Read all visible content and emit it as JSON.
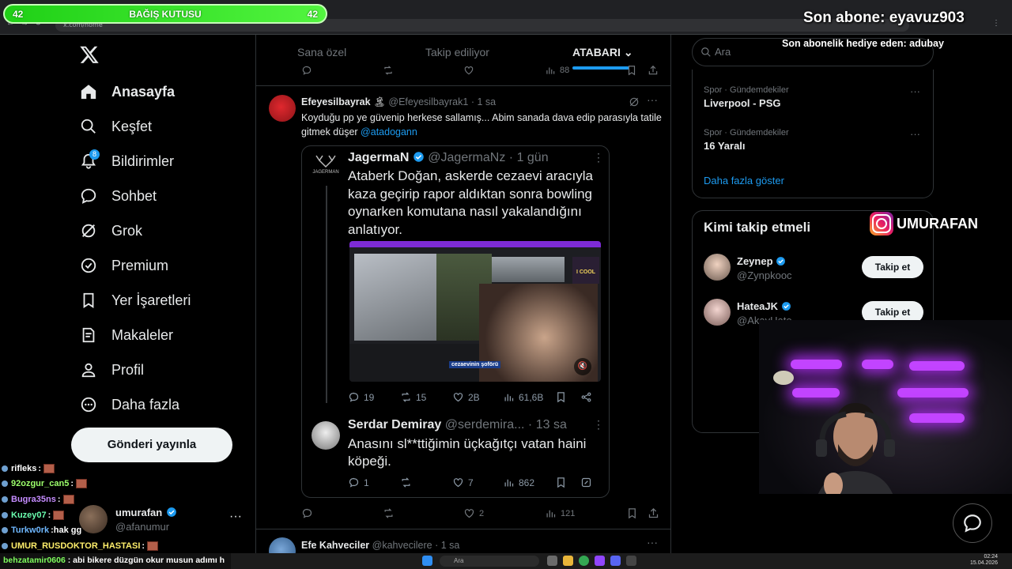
{
  "browser": {
    "address": "x.com/home"
  },
  "overlay": {
    "donation_left": "42",
    "donation_title": "BAĞIŞ KUTUSU",
    "donation_right": "42",
    "son_abone": "Son abone: eyavuz903",
    "son_hediye": "Son abonelik hediye eden: adubay",
    "instagram_handle": "UMURAFAN"
  },
  "nav": {
    "items": [
      {
        "label": "Anasayfa",
        "icon": "home-icon"
      },
      {
        "label": "Keşfet",
        "icon": "search-icon"
      },
      {
        "label": "Bildirimler",
        "icon": "bell-icon",
        "badge": "8"
      },
      {
        "label": "Sohbet",
        "icon": "chat-icon"
      },
      {
        "label": "Grok",
        "icon": "grok-icon"
      },
      {
        "label": "Premium",
        "icon": "verified-icon"
      },
      {
        "label": "Yer İşaretleri",
        "icon": "bookmark-icon"
      },
      {
        "label": "Makaleler",
        "icon": "article-icon"
      },
      {
        "label": "Profil",
        "icon": "person-icon"
      },
      {
        "label": "Daha fazla",
        "icon": "more-circle-icon"
      }
    ],
    "post_button": "Gönderi yayınla"
  },
  "profile": {
    "name": "umurafan",
    "handle": "@afanumur",
    "more": "···"
  },
  "chat": [
    {
      "user": "rifleks",
      "msg": "",
      "color": "#ffffff"
    },
    {
      "user": "92ozgur_can5",
      "msg": "",
      "color": "#9cff6b"
    },
    {
      "user": "Bugra35ns",
      "msg": "",
      "color": "#c58cff"
    },
    {
      "user": "Kuzey07",
      "msg": "",
      "color": "#6bffb0"
    },
    {
      "user": "Turkw0rk",
      "msg": "hak gg",
      "color": "#6fb8ff"
    },
    {
      "user": "UMUR_RUSDOKTOR_HASTASI",
      "msg": "",
      "color": "#ffef6b"
    }
  ],
  "chat_input": {
    "user": "behzatamir0606",
    "msg": "abi bikere düzgün okur musun adımı h"
  },
  "feed": {
    "tabs": [
      "Sana özel",
      "Takip ediliyor",
      "ATABARI"
    ],
    "top_actions": {
      "views": "88"
    },
    "tweet": {
      "name": "Efeyesilbayrak",
      "handle": "@Efeyesilbayrak1",
      "time": "1 sa",
      "text": "Koyduğu pp ye güvenip herkese sallamış... Abim sanada dava edip parasıyla tatile gitmek düşer",
      "mention": "@atadogann",
      "quote": {
        "logo": "JAGERMAN",
        "name": "JagermaN",
        "handle": "@JagermaNz",
        "time": "1 gün",
        "text": "Ataberk Doğan, askerde cezaevi aracıyla kaza geçirip rapor aldıktan sonra bowling oynarken komutana nasıl yakalandığını anlatıyor.",
        "media_caption": "cezaevinin şoförü",
        "media_tag": "I COOL",
        "stats": {
          "replies": "19",
          "reposts": "15",
          "likes": "2B",
          "views": "61,6B"
        },
        "reply": {
          "name": "Serdar Demiray",
          "handle": "@serdemira...",
          "time": "13 sa",
          "text": "Anasını sl**ttiğimin üçkağıtçı vatan haini köpeği.",
          "stats": {
            "replies": "1",
            "reposts": "",
            "likes": "7",
            "views": "862"
          }
        }
      },
      "stats": {
        "replies": "",
        "reposts": "",
        "likes": "2",
        "views": "121"
      }
    },
    "next_tweet": {
      "name": "Efe Kahveciler",
      "handle": "@kahvecilere",
      "time": "1 sa"
    }
  },
  "sidebar": {
    "search_placeholder": "Ara",
    "trends": [
      {
        "category": "Spor · Gündemdekiler",
        "title": "Liverpool - PSG"
      },
      {
        "category": "Spor · Gündemdekiler",
        "title": "16 Yaralı"
      }
    ],
    "show_more": "Daha fazla göster",
    "who_to_follow_title": "Kimi takip etmeli",
    "follow": [
      {
        "name": "Zeynep",
        "handle": "@Zynpkooc",
        "button": "Takip et"
      },
      {
        "name": "HateaJK",
        "handle": "@AkayHate",
        "button": "Takip et"
      }
    ]
  },
  "taskbar": {
    "search": "Ara",
    "time": "02:24",
    "date": "15.04.2026"
  },
  "colors": {
    "accent": "#1d9bf0",
    "background": "#000000",
    "border": "#2f3336",
    "muted": "#71767b",
    "donation_green": "#2fe022",
    "purple_light": "#c244ff"
  }
}
